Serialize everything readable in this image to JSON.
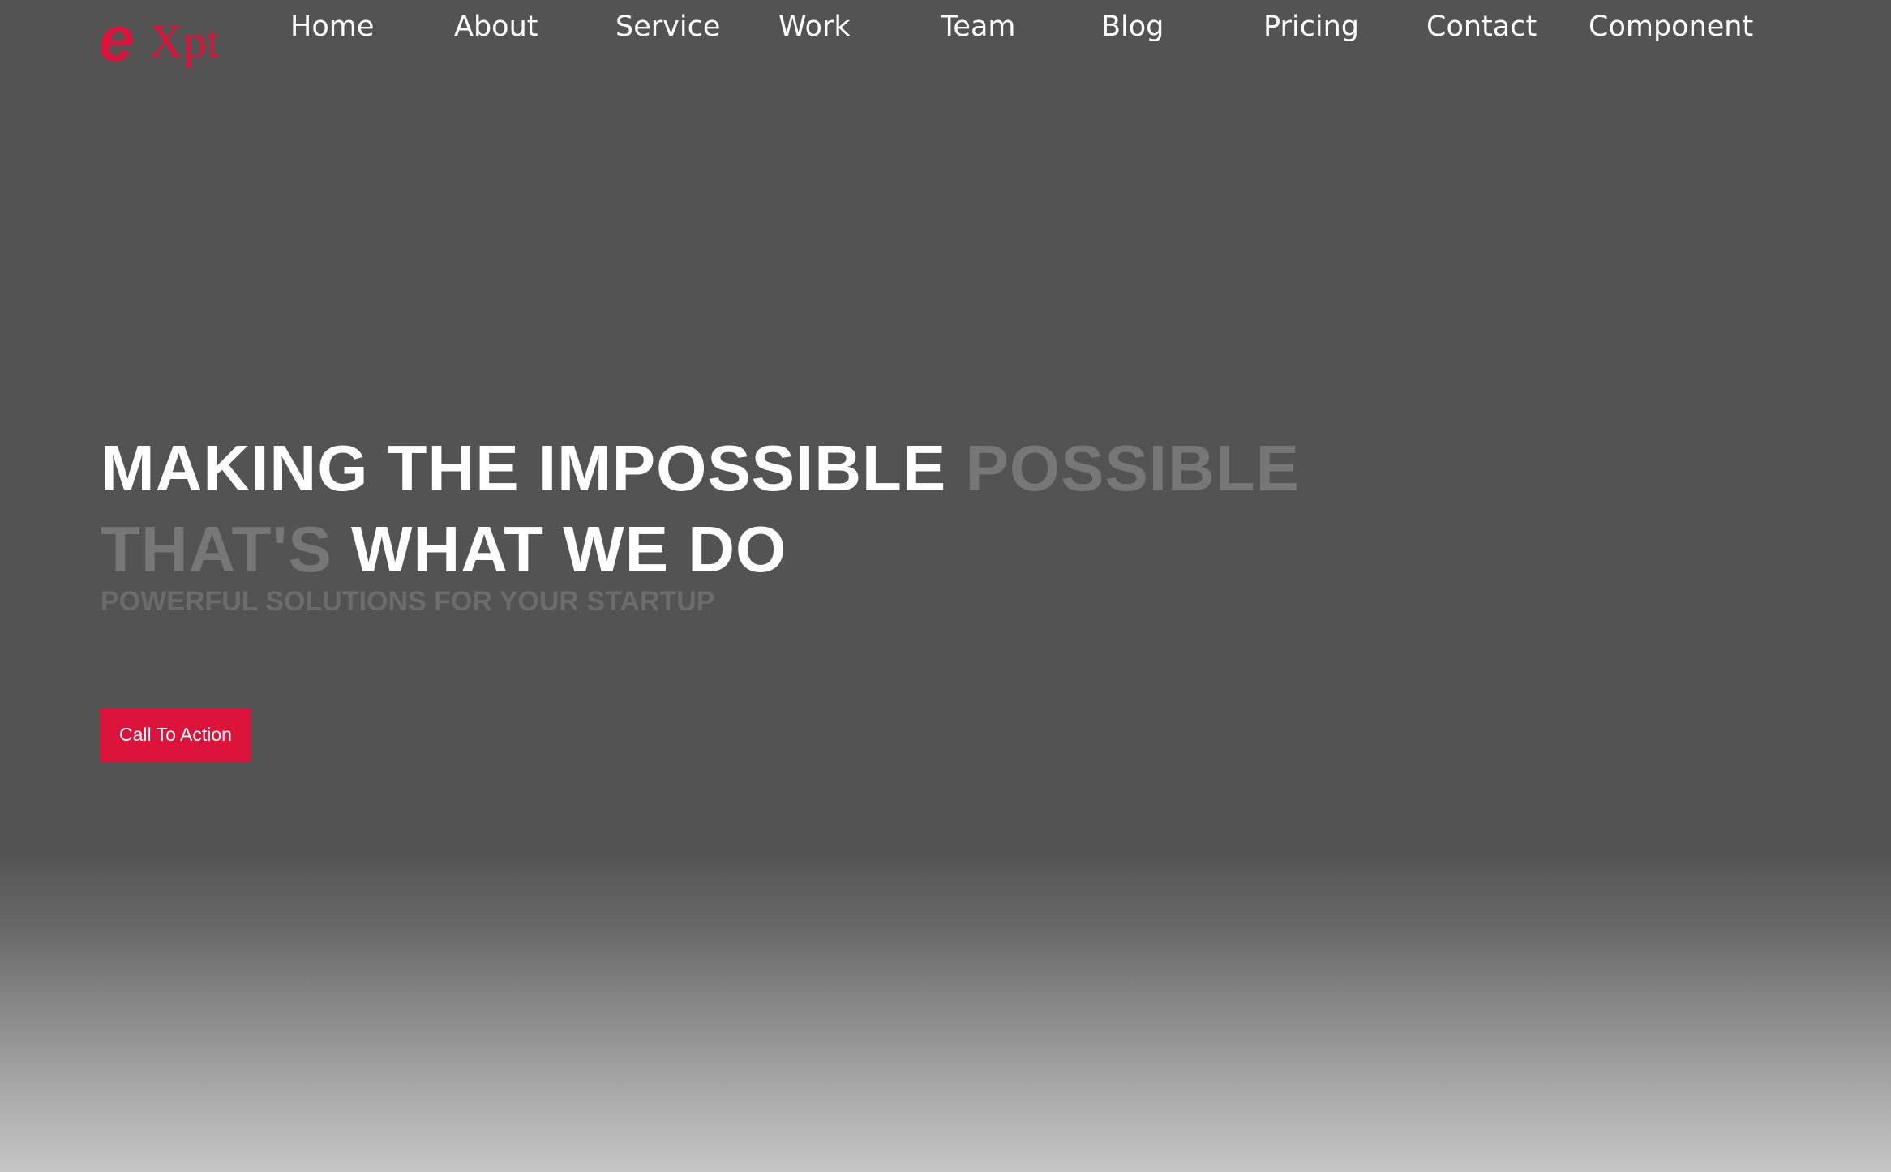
{
  "logo": {
    "letter": "e",
    "rest": "Xpt"
  },
  "nav": {
    "home": "Home",
    "about": "About",
    "service": "Service",
    "work": "Work",
    "team": "Team",
    "blog": "Blog",
    "pricing": "Pricing",
    "contact": "Contact",
    "component": "Component"
  },
  "hero": {
    "line1_white": "MAKING THE IMPOSSIBLE",
    "line1_muted": "POSSIBLE",
    "line2_muted": "THAT'S",
    "line2_white": "WHAT WE DO",
    "subtitle": "POWERFUL SOLUTIONS FOR YOUR STARTUP",
    "cta_label": "Call To Action"
  },
  "colors": {
    "accent": "#dc143c",
    "background": "#535353",
    "heading_white": "#ffffff",
    "heading_muted": "#777777"
  }
}
